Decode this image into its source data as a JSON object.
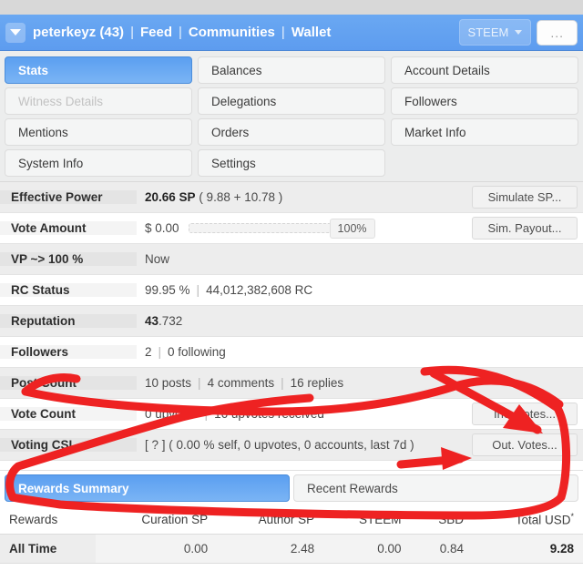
{
  "header": {
    "menu_caret_icon": "caret-down-icon",
    "username": "peterkeyz (43)",
    "links": [
      "Feed",
      "Communities",
      "Wallet"
    ],
    "separator": "|",
    "currency_label": "STEEM",
    "currency_caret_icon": "chevron-down-icon",
    "more_label": "...",
    "bg_color": "#5d9cef"
  },
  "tabs": [
    {
      "label": "Stats",
      "state": "active"
    },
    {
      "label": "Balances",
      "state": "normal"
    },
    {
      "label": "Account Details",
      "state": "normal"
    },
    {
      "label": "Witness Details",
      "state": "disabled"
    },
    {
      "label": "Delegations",
      "state": "normal"
    },
    {
      "label": "Followers",
      "state": "normal"
    },
    {
      "label": "Mentions",
      "state": "normal"
    },
    {
      "label": "Orders",
      "state": "normal"
    },
    {
      "label": "Market Info",
      "state": "normal"
    },
    {
      "label": "System Info",
      "state": "normal"
    },
    {
      "label": "Settings",
      "state": "normal"
    },
    {
      "label": "",
      "state": "empty"
    }
  ],
  "stats": [
    {
      "label": "Effective Power",
      "value_bold": "20.66 SP",
      "value_rest": "( 9.88 + 10.78 )",
      "button": "Simulate SP..."
    },
    {
      "label": "Vote Amount",
      "value_bold": "",
      "value_rest": "$ 0.00",
      "slider_value": "100%",
      "button": "Sim. Payout..."
    },
    {
      "label": "VP ~> 100 %",
      "value_bold": "",
      "value_rest": "Now",
      "button": ""
    },
    {
      "label": "RC Status",
      "value_bold": "",
      "value_rest": "99.95 %",
      "value_sep": "|",
      "value_tail": "44,012,382,608 RC",
      "button": ""
    },
    {
      "label": "Reputation",
      "value_bold": "43",
      "value_rest": ".732",
      "button": ""
    },
    {
      "label": "Followers",
      "value_bold": "",
      "value_rest": "2",
      "value_sep": "|",
      "value_tail": "0 following",
      "button": ""
    },
    {
      "label": "Post Count",
      "value_bold": "",
      "value_rest": "10 posts",
      "value_sep": "|",
      "value_tail": "4 comments",
      "value_sep2": "|",
      "value_tail2": "16 replies",
      "button": ""
    },
    {
      "label": "Vote Count",
      "value_bold": "",
      "value_rest": "0 upvotes",
      "value_sep": "|",
      "value_tail": "16 upvotes received",
      "button": "Inc. Votes..."
    },
    {
      "label": "Voting CSI",
      "value_bold": "",
      "value_rest": "[ ? ] ( 0.00 % self, 0 upvotes, 0 accounts, last 7d )",
      "button": "Out. Votes..."
    }
  ],
  "rewards_tabs": [
    {
      "label": "Rewards Summary",
      "state": "active"
    },
    {
      "label": "Recent Rewards",
      "state": "normal"
    }
  ],
  "rewards_table": {
    "headers": [
      "Rewards",
      "Curation SP",
      "Author SP",
      "STEEM",
      "SBD",
      "Total USD"
    ],
    "total_usd_marker": "*",
    "rows": [
      {
        "cells": [
          "All Time",
          "0.00",
          "2.48",
          "0.00",
          "0.84",
          "9.28"
        ]
      }
    ]
  },
  "annotations": {
    "color": "#ee2222",
    "marks": [
      {
        "name": "arrow-to-inc-votes",
        "kind": "arrow"
      },
      {
        "name": "arrow-to-out-votes",
        "kind": "arrow"
      },
      {
        "name": "enclosing-loop",
        "kind": "loop"
      }
    ]
  }
}
